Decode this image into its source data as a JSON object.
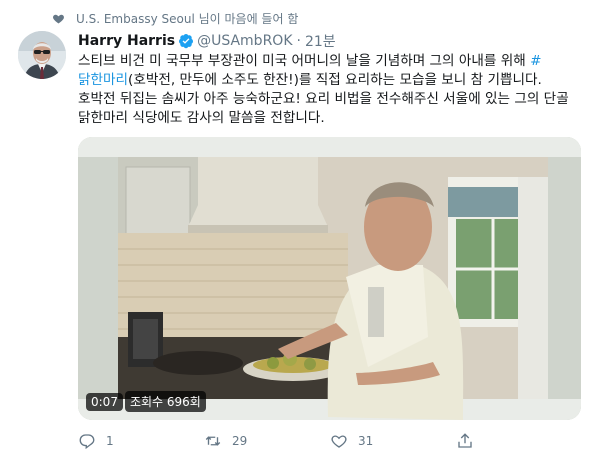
{
  "social_context": {
    "icon": "heart-icon",
    "text": "U.S. Embassy Seoul 님이 마음에 들어 함"
  },
  "tweet": {
    "author_name": "Harry Harris",
    "verified_icon": "verified-badge-icon",
    "handle": "@USAmbROK",
    "separator": "·",
    "time": "21분",
    "text_before": "스티브 비건 미 국무부 부장관이 미국 어머니의 날을 기념하며 그의 아내를 위해 ",
    "hashtag": "#닭한마리",
    "text_after": "(호박전, 만두에 소주도 한잔!)를 직접 요리하는 모습을 보니 참 기쁩니다. 호박전 뒤집는 솜씨가 아주 능숙하군요! 요리 비법을 전수해주신 서울에 있는 그의 단골 닭한마리 식당에도 감사의 말씀을 전합니다."
  },
  "media": {
    "type": "video",
    "duration": "0:07",
    "views": "조회수 696회"
  },
  "actions": {
    "reply_count": "1",
    "retweet_count": "29",
    "like_count": "31",
    "reply_icon": "reply-icon",
    "retweet_icon": "retweet-icon",
    "like_icon": "heart-outline-icon",
    "share_icon": "share-icon"
  },
  "colors": {
    "link": "#1b95e0",
    "muted": "#657786",
    "text": "#14171a"
  }
}
